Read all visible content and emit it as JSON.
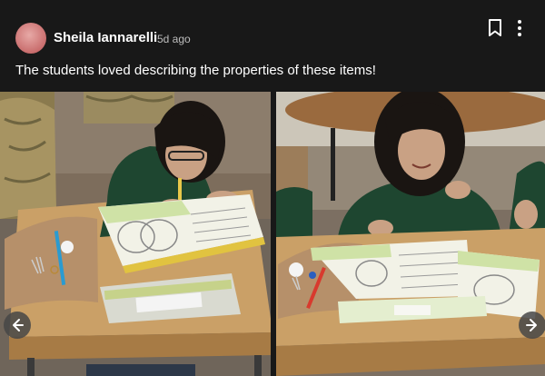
{
  "post": {
    "author": "Sheila Iannarelli",
    "time": "5d ago",
    "caption": "The students loved describing the properties of these items!"
  },
  "icons": {
    "bookmark": "bookmark-icon",
    "more": "more-vertical-icon",
    "prev": "chevron-left-icon",
    "next": "chevron-right-icon"
  },
  "colors": {
    "background": "#181818",
    "text": "#ffffff",
    "muted": "#bdbdbd",
    "avatar": "#d98a88"
  }
}
